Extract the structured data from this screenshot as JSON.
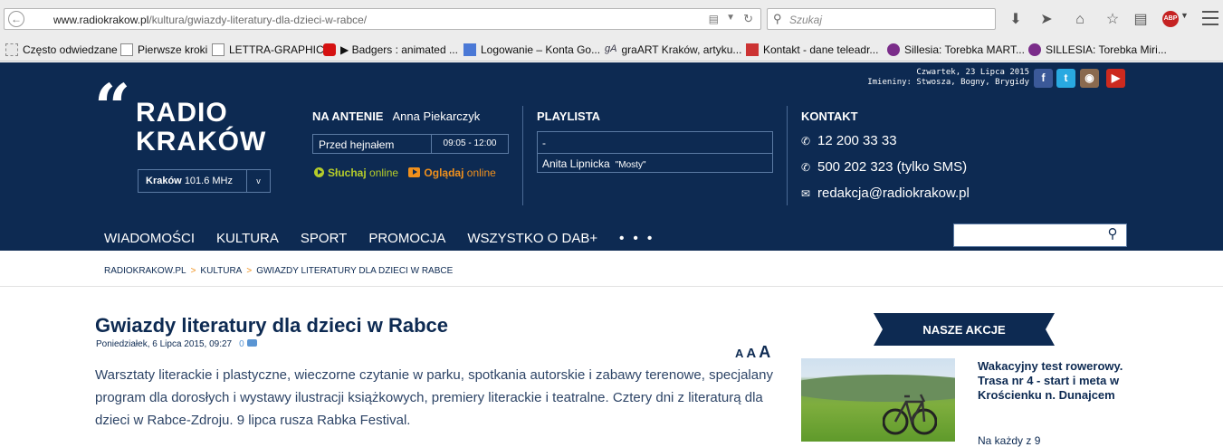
{
  "browser": {
    "url_host": "www.radiokrakow.pl",
    "url_path": "/kultura/gwiazdy-literatury-dla-dzieci-w-rabce/",
    "search_placeholder": "Szukaj",
    "abp_label": "ABP"
  },
  "bookmarks": [
    {
      "label": "Często odwiedzane",
      "icon": "folder-icon"
    },
    {
      "label": "Pierwsze kroki",
      "icon": "page-icon"
    },
    {
      "label": "LETTRA-GRAPHIC",
      "icon": "page-icon"
    },
    {
      "label": "▶ Badgers : animated ...",
      "icon": "youtube-icon"
    },
    {
      "label": "Logowanie – Konta Go...",
      "icon": "google-icon"
    },
    {
      "label": "graART Kraków, artyku...",
      "icon": "graart-icon"
    },
    {
      "label": "Kontakt - dane teleadr...",
      "icon": "royal-icon"
    },
    {
      "label": "Sillesia: Torebka MART...",
      "icon": "heart-icon"
    },
    {
      "label": "SILLESIA: Torebka Miri...",
      "icon": "heart-icon"
    }
  ],
  "header": {
    "date": "Czwartek, 23 Lipca 2015",
    "namedays": "Imieniny: Stwosza, Bogny, Brygidy",
    "logo_line1": "RADIO",
    "logo_line2": "KRAKÓW",
    "station_name": "Kraków",
    "station_freq": "101.6 MHz",
    "station_arrow": "v",
    "social": [
      {
        "name": "facebook-icon",
        "glyph": "f",
        "color": "#3b5998"
      },
      {
        "name": "twitter-icon",
        "glyph": "t",
        "color": "#29a9e1"
      },
      {
        "name": "instagram-icon",
        "glyph": "◉",
        "color": "#8a6a4f"
      },
      {
        "name": "youtube-icon",
        "glyph": "▶",
        "color": "#cc2a1f"
      }
    ]
  },
  "on_air": {
    "label": "NA ANTENIE",
    "host": "Anna Piekarczyk",
    "show": "Przed hejnałem",
    "time": "09:05 - 12:00",
    "listen": "Słuchaj",
    "listen_suffix": "online",
    "watch": "Oglądaj",
    "watch_suffix": "online"
  },
  "playlist": {
    "label": "PLAYLISTA",
    "row1": "-",
    "artist": "Anita Lipnicka",
    "song": "\"Mosty\""
  },
  "contact": {
    "label": "KONTAKT",
    "phone": "12 200 33 33",
    "sms": "500 202 323 (tylko SMS)",
    "email": "redakcja@radiokrakow.pl"
  },
  "nav": {
    "items": [
      "WIADOMOŚCI",
      "KULTURA",
      "SPORT",
      "PROMOCJA",
      "WSZYSTKO O DAB+"
    ],
    "more": "• • •"
  },
  "breadcrumb": [
    "RADIOKRAKOW.PL",
    "KULTURA",
    "GWIAZDY LITERATURY DLA DZIECI W RABCE"
  ],
  "article": {
    "title": "Gwiazdy literatury dla dzieci w Rabce",
    "date": "Poniedziałek, 6 Lipca 2015, 09:27",
    "comments": "0",
    "font_small": "A",
    "font_medium": "A",
    "font_large": "A",
    "lead": "Warsztaty literackie i plastyczne, wieczorne czytanie w parku, spotkania autorskie i zabawy terenowe, specjalany program dla dorosłych i wystawy ilustracji książkowych, premiery literackie i teatralne. Cztery dni z literaturą dla dzieci w Rabce-Zdroju. 9 lipca rusza Rabka Festival."
  },
  "sidebar": {
    "section_title": "NASZE AKCJE",
    "item_title": "Wakacyjny test rowerowy. Trasa nr 4 - start i meta w Krościenku n. Dunajcem",
    "item_excerpt": "Na każdy z 9"
  }
}
